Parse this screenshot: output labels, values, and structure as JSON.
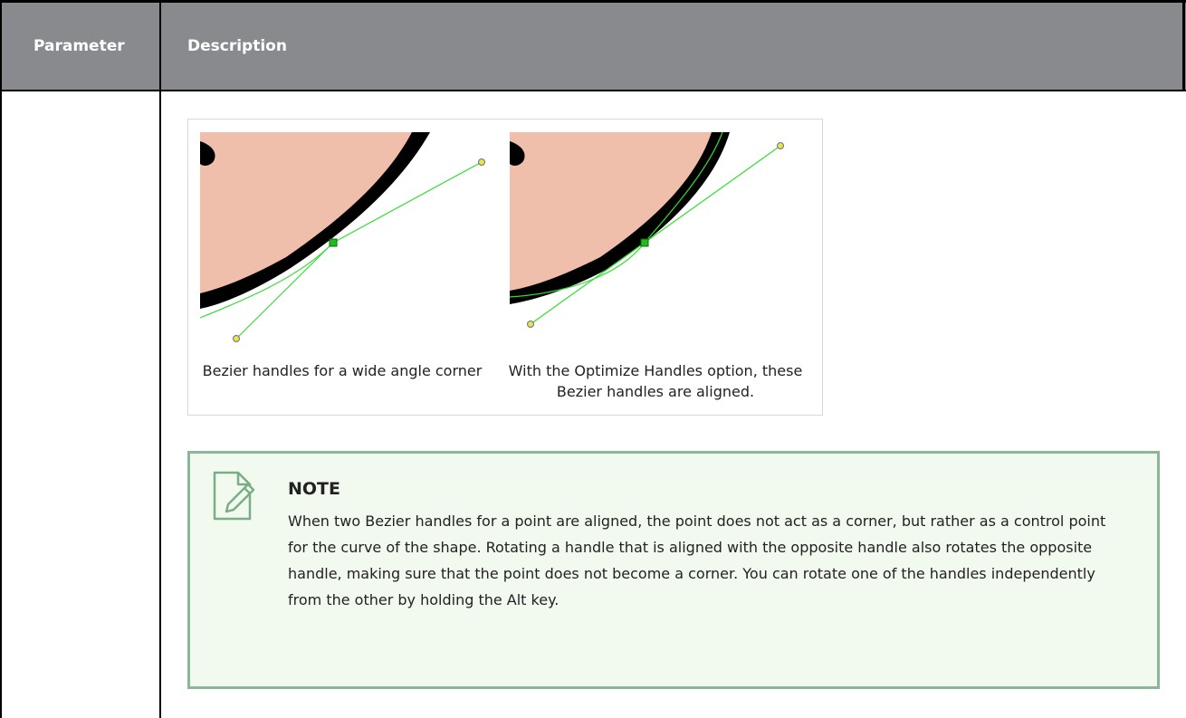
{
  "table": {
    "headers": [
      "Parameter",
      "Description"
    ]
  },
  "figure": {
    "captions": [
      "Bezier handles for a wide angle corner",
      "With the Optimize Handles option, these Bezier handles are aligned."
    ]
  },
  "note": {
    "icon": "note-edit-icon",
    "title": "NOTE",
    "body": "When two Bezier handles for a point are aligned, the point does not act as a corner, but rather as a control point for the curve of the shape. Rotating a handle that is aligned with the opposite handle also rotates the opposite handle, making sure that the point does not become a corner. You can rotate one of the handles independently from the other by holding the Alt key."
  },
  "colors": {
    "header_bg": "#898a8e",
    "note_bg": "#f2f9ef",
    "note_border": "#88b896",
    "skin": "#f0bfab",
    "handle_line": "#33dd33"
  }
}
